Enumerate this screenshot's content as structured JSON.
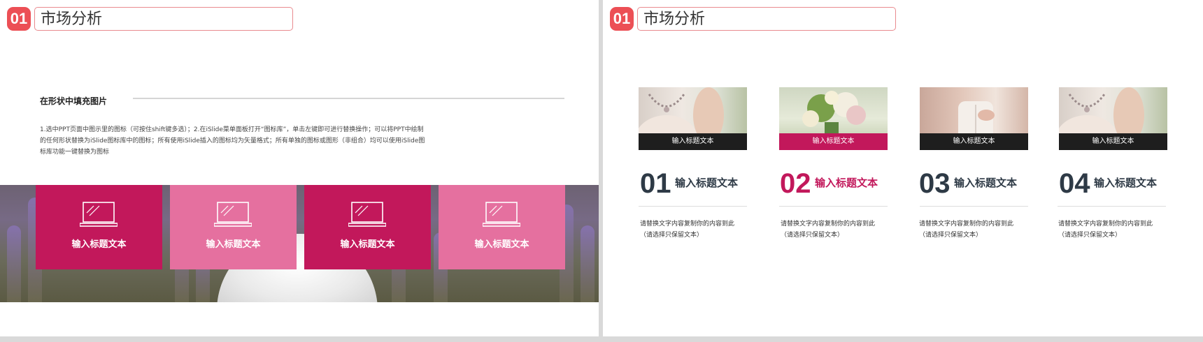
{
  "header": {
    "number": "01",
    "title": "市场分析"
  },
  "left": {
    "section_heading": "在形状中填充图片",
    "description": "1.选中PPT页面中图示里的图标（可按住shift键多选）；2.在iSlide菜单面板打开“图标库”，单击左键即可进行替换操作；可以将PPT中绘制的任何形状替换为iSlide图标库中的图标；所有使用iSlide插入的图标均为矢量格式；所有单独的图标或图形（非组合）均可以使用iSlide图标库功能一键替换为图标",
    "tiles": [
      {
        "label": "输入标题文本",
        "color": "#c2185b",
        "icon": "laptop-icon"
      },
      {
        "label": "输入标题文本",
        "color": "#e5709f",
        "icon": "laptop-icon"
      },
      {
        "label": "输入标题文本",
        "color": "#c2185b",
        "icon": "laptop-icon"
      },
      {
        "label": "输入标题文本",
        "color": "#e5709f",
        "icon": "laptop-icon"
      }
    ]
  },
  "right": {
    "cards": [
      {
        "caption": "输入标题文本",
        "number": "01",
        "title": "输入标题文本",
        "desc1": "请替换文字内容复制你的内容到此",
        "desc2": "（请选择只保留文本）",
        "accent": "#2e3a46",
        "caption_bg": "#1e1e1e",
        "photo": "necklace"
      },
      {
        "caption": "输入标题文本",
        "number": "02",
        "title": "输入标题文本",
        "desc1": "请替换文字内容复制你的内容到此",
        "desc2": "（请选择只保留文本）",
        "accent": "#c2185b",
        "caption_bg": "#c2185b",
        "photo": "bouquet"
      },
      {
        "caption": "输入标题文本",
        "number": "03",
        "title": "输入标题文本",
        "desc1": "请替换文字内容复制你的内容到此",
        "desc2": "（请选择只保留文本）",
        "accent": "#2e3a46",
        "caption_bg": "#1e1e1e",
        "photo": "dress-back"
      },
      {
        "caption": "输入标题文本",
        "number": "04",
        "title": "输入标题文本",
        "desc1": "请替换文字内容复制你的内容到此",
        "desc2": "（请选择只保留文本）",
        "accent": "#2e3a46",
        "caption_bg": "#1e1e1e",
        "photo": "necklace"
      }
    ]
  }
}
